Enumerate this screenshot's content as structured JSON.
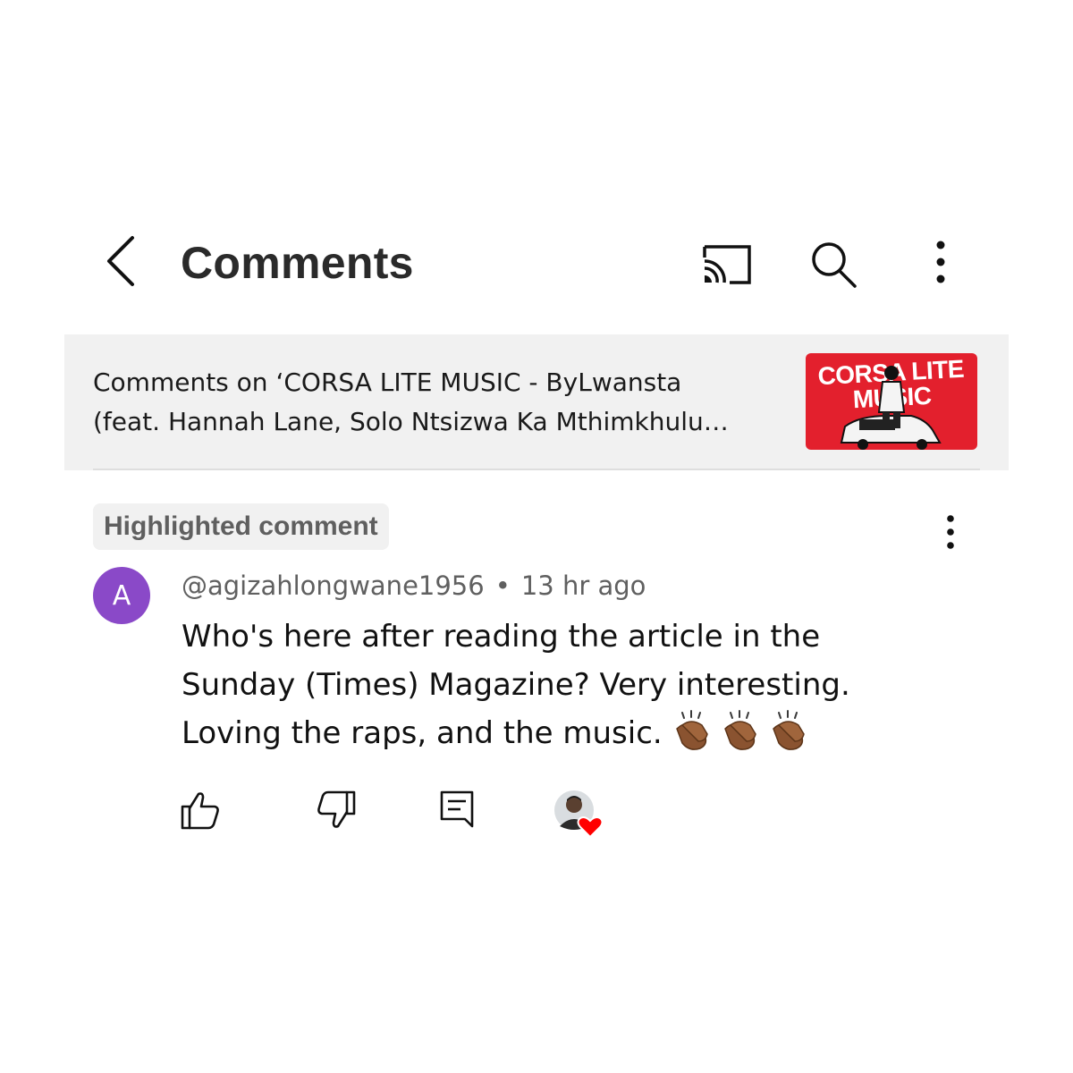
{
  "header": {
    "title": "Comments",
    "back_icon": "chevron-left-icon",
    "cast_icon": "cast-icon",
    "search_icon": "search-icon",
    "more_icon": "more-vertical-icon"
  },
  "video_context": {
    "line1": "Comments on ‘CORSA LITE MUSIC - ByLwansta",
    "line2": "(feat. Hannah Lane, Solo Ntsizwa Ka Mthimkhulu…",
    "thumbnail_text_line1": "CORSA LITE",
    "thumbnail_text_line2": "MUSIC",
    "thumbnail_color": "#e3202d"
  },
  "comment": {
    "badge": "Highlighted comment",
    "avatar_letter": "A",
    "avatar_color": "#8a49c8",
    "author": "@agizahlongwane1956",
    "separator": "•",
    "time": "13 hr ago",
    "text_line1": "Who's here after reading the article in the",
    "text_line2": "Sunday (Times) Magazine? Very interesting.",
    "text_line3": "Loving the raps, and the music.",
    "emojis": [
      "clapping-hands-icon",
      "clapping-hands-icon",
      "clapping-hands-icon"
    ]
  },
  "actions": {
    "like_icon": "thumbs-up-icon",
    "dislike_icon": "thumbs-down-icon",
    "reply_icon": "reply-icon",
    "creator_heart_icon": "creator-heart-icon",
    "heart_color": "#ff0000"
  }
}
